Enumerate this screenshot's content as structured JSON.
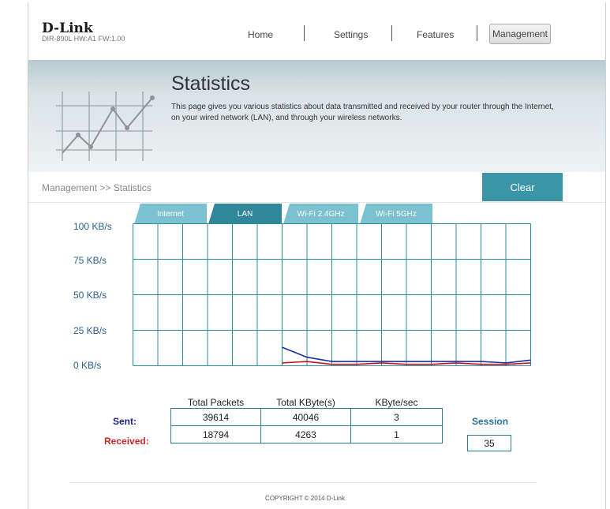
{
  "brand": {
    "logo": "D-Link",
    "model_info": "DIR-890L   HW:A1   FW:1.00"
  },
  "nav": {
    "home": "Home",
    "settings": "Settings",
    "features": "Features",
    "management": "Management"
  },
  "banner": {
    "title": "Statistics",
    "description": "This page gives you various statistics about data transmitted and received by your router through the Internet, on your wired network (LAN), and through your wireless networks."
  },
  "breadcrumb": "Management >> Statistics",
  "clear_label": "Clear",
  "tabs": [
    {
      "label": "Internet",
      "active": false
    },
    {
      "label": "LAN",
      "active": true
    },
    {
      "label": "Wi-Fi 2.4GHz",
      "active": false
    },
    {
      "label": "Wi-Fi 5GHz",
      "active": false
    }
  ],
  "chart_data": {
    "type": "line",
    "ytick_labels": [
      "100 KB/s",
      "75 KB/s",
      "50 KB/s",
      "25 KB/s",
      "0 KB/s"
    ],
    "ylim": [
      0,
      100
    ],
    "grid": true,
    "x": [
      6,
      7,
      8,
      9,
      10,
      11,
      12,
      13,
      14,
      15,
      16
    ],
    "xlim": [
      0,
      16
    ],
    "series": [
      {
        "name": "Sent",
        "color": "#1a2ea8",
        "values": [
          13,
          6,
          3,
          3,
          3,
          3,
          3,
          3,
          3,
          2,
          4
        ]
      },
      {
        "name": "Received",
        "color": "#c4161c",
        "values": [
          2,
          3,
          1,
          1,
          2,
          1,
          1,
          2,
          1,
          1,
          2
        ]
      }
    ]
  },
  "stats_table": {
    "headers": [
      "Total Packets",
      "Total KByte(s)",
      "KByte/sec"
    ],
    "sent": {
      "label": "Sent:",
      "color": "#1a237e",
      "values": [
        "39614",
        "40046",
        "3"
      ]
    },
    "received": {
      "label": "Received:",
      "color": "#c62828",
      "values": [
        "18794",
        "4263",
        "1"
      ]
    }
  },
  "session": {
    "label": "Session",
    "value": "35"
  },
  "footer": "COPYRIGHT © 2014 D-Link"
}
